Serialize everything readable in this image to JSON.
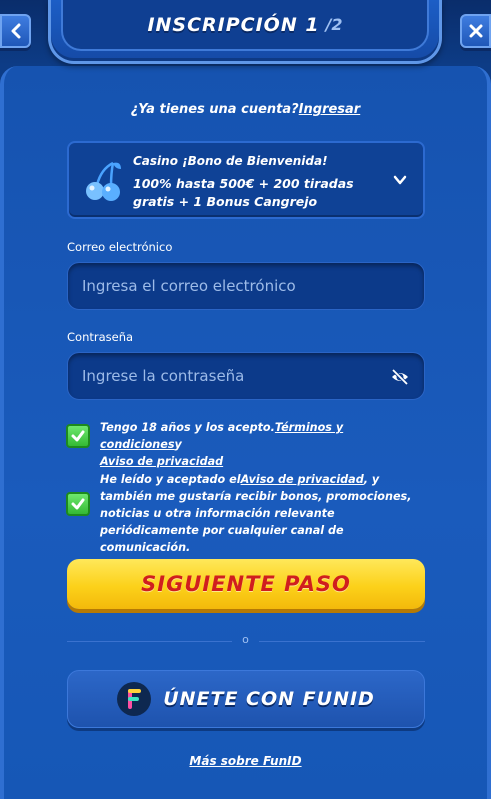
{
  "header": {
    "title": "Inscripción 1",
    "step": "/2",
    "back_icon": "chevron-left-icon",
    "close_icon": "close-icon"
  },
  "login": {
    "prompt": "¿Ya tienes una cuenta?",
    "link": "Ingresar"
  },
  "bonus": {
    "icon": "cherry-icon",
    "title": "Casino ¡Bono de Bienvenida!",
    "description": "100% hasta 500€ + 200 tiradas gratis + 1 Bonus Cangrejo",
    "expand_icon": "chevron-down-icon"
  },
  "email": {
    "label": "Correo electrónico",
    "placeholder": "Ingresa el correo electrónico",
    "value": ""
  },
  "password": {
    "label": "Contraseña",
    "placeholder": "Ingrese la contraseña",
    "value": "",
    "toggle_icon": "eye-off-icon"
  },
  "terms": {
    "checked": true,
    "text_prefix": "Tengo 18 años y los acepto.",
    "terms_link": "Términos y condiciones",
    "connector": "y",
    "privacy_link": "Aviso de privacidad"
  },
  "marketing": {
    "checked": true,
    "text_prefix": "He leído y aceptado el",
    "privacy_link": "Aviso de privacidad",
    "text_suffix": ", y también me gustaría recibir bonos, promociones, noticias u otra información relevante periódicamente por cualquier canal de comunicación."
  },
  "actions": {
    "next_label": "Siguiente paso",
    "divider_label": "o",
    "funid_label": "Únete con FunID",
    "more_funid": "Más sobre FunID"
  },
  "colors": {
    "background": "#0d3c86",
    "panel": "#1a5bbc",
    "primary_button": "#fcd11a",
    "primary_button_text": "#d01e1e",
    "checkbox": "#34b934"
  }
}
